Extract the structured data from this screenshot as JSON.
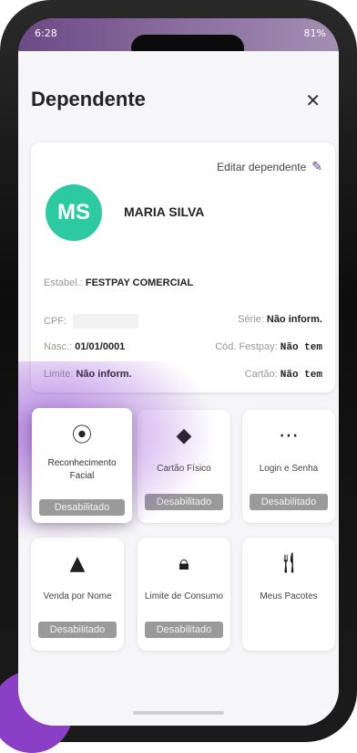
{
  "status_bar": {
    "time": "6:28",
    "battery": "81%"
  },
  "header": {
    "title": "Dependente",
    "close_icon": "close-icon"
  },
  "dependent": {
    "edit_label": "Editar dependente",
    "initials": "MS",
    "name": "MARIA SILVA",
    "establishment_label": "Estabel.:",
    "establishment_value": "FESTPAY COMERCIAL",
    "cpf_label": "CPF:",
    "serie_label": "Série:",
    "serie_value": "Não inform.",
    "nasc_label": "Nasc.:",
    "nasc_value": "01/01/0001",
    "cod_label": "Cód. Festpay:",
    "cod_value": "Não tem",
    "limite_label": "Limite:",
    "limite_value": "Não inform.",
    "cartao_label": "Cartão:",
    "cartao_value": "Não tem"
  },
  "tiles": [
    {
      "label": "Reconhecimento Facial",
      "status": "Desabilitado",
      "icon": "face-recognition-icon"
    },
    {
      "label": "Cartão Físico",
      "status": "Desabilitado",
      "icon": "card-icon"
    },
    {
      "label": "Login e Senha",
      "status": "Desabilitado",
      "icon": "password-icon"
    },
    {
      "label": "Venda por Nome",
      "status": "Desabilitado",
      "icon": "person-icon"
    },
    {
      "label": "Limite de Consumo",
      "status": "Desabilitado",
      "icon": "lock-icon"
    },
    {
      "label": "Meus Pacotes",
      "status": "",
      "icon": "cutlery-icon"
    }
  ],
  "colors": {
    "avatar": "#2dc9a2",
    "accent": "#5b3b86",
    "badge": "#9a9a9a"
  }
}
